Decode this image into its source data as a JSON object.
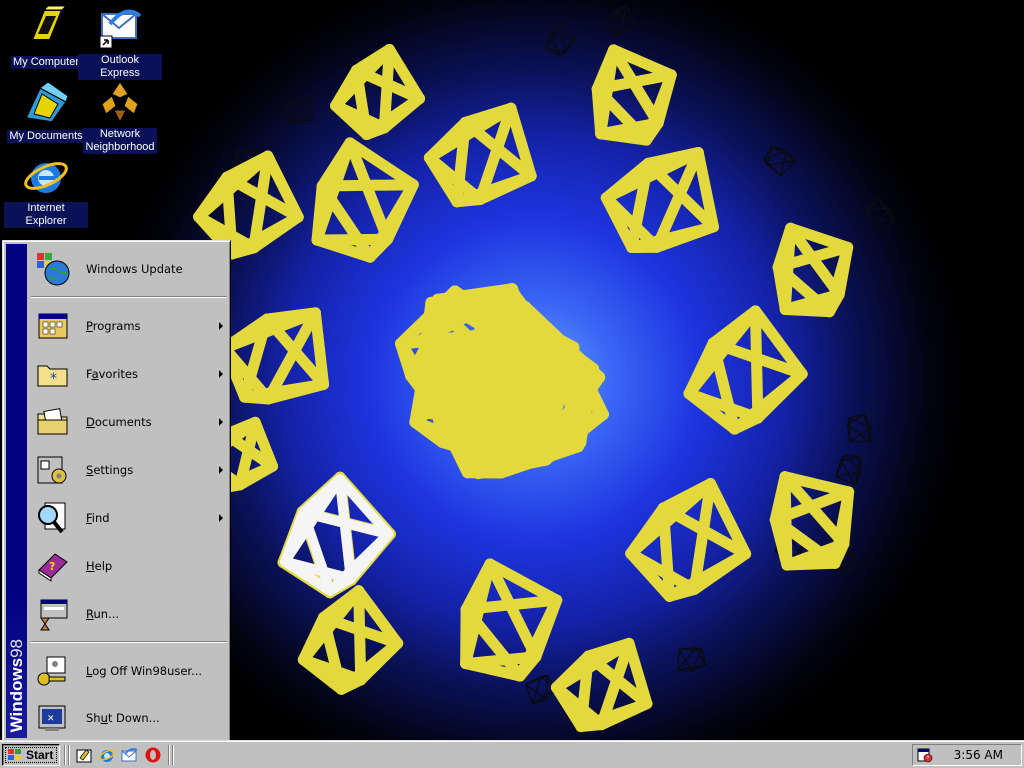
{
  "desktop": {
    "icons": [
      {
        "label": "My Computer",
        "icon": "my-computer-icon"
      },
      {
        "label": "Outlook Express",
        "icon": "outlook-express-icon"
      },
      {
        "label": "My Documents",
        "icon": "my-documents-icon"
      },
      {
        "label": "Network\nNeighborhood",
        "icon": "network-neighborhood-icon"
      },
      {
        "label": "Internet Explorer",
        "icon": "internet-explorer-icon"
      }
    ],
    "wallpaper_colors": {
      "center": "#6ea7ff",
      "mid": "#1e35e0",
      "edge": "#000000",
      "shape": "#e3d93c"
    }
  },
  "start_menu": {
    "banner": {
      "bold": "Windows",
      "light": "98"
    },
    "items": [
      {
        "label": "Windows Update",
        "icon": "windows-update-icon",
        "submenu": false
      },
      {
        "label": "Programs",
        "accel": "P",
        "icon": "programs-icon",
        "submenu": true
      },
      {
        "label": "Favorites",
        "accel": "a",
        "icon": "favorites-folder-icon",
        "submenu": true
      },
      {
        "label": "Documents",
        "accel": "D",
        "icon": "documents-folder-icon",
        "submenu": true
      },
      {
        "label": "Settings",
        "accel": "S",
        "icon": "settings-icon",
        "submenu": true
      },
      {
        "label": "Find",
        "accel": "F",
        "icon": "find-icon",
        "submenu": true
      },
      {
        "label": "Help",
        "accel": "H",
        "icon": "help-book-icon",
        "submenu": false
      },
      {
        "label": "Run...",
        "accel": "R",
        "icon": "run-icon",
        "submenu": false
      },
      {
        "label": "Log Off Win98user...",
        "accel": "L",
        "icon": "log-off-key-icon",
        "submenu": false
      },
      {
        "label": "Shut Down...",
        "accel": "u",
        "icon": "shut-down-icon",
        "submenu": false
      }
    ]
  },
  "taskbar": {
    "start_label": "Start",
    "quick_launch": [
      "show-desktop-icon",
      "internet-explorer-icon",
      "outlook-express-icon",
      "opera-icon"
    ],
    "clock": "3:56 AM",
    "tray_icons": [
      "task-scheduler-icon"
    ]
  },
  "colors": {
    "banner": "#000080",
    "chrome": "#c0c0c0",
    "label_bg": "#0a1157"
  }
}
